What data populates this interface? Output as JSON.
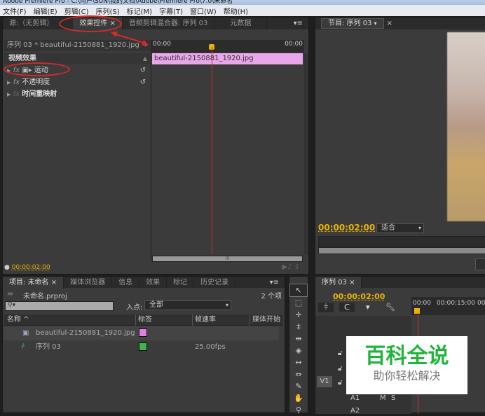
{
  "window": {
    "title": "Adobe Premiere Pro - C:\\用户\\SUN\\我的文档\\Adobe\\Premiere Pro\\7.0\\未命名"
  },
  "menu": [
    "文件(F)",
    "编辑(E)",
    "剪辑(C)",
    "序列(S)",
    "标记(M)",
    "字幕(T)",
    "窗口(W)",
    "帮助(H)"
  ],
  "top_left": {
    "tabs": [
      "源:（无剪辑）",
      "效果控件 ×",
      "音频剪辑混合器: 序列 03",
      "元数据"
    ],
    "header": "序列 03 * beautiful-2150881_1920.jpg",
    "ruler_start": "00:00",
    "ruler_end": "00:00",
    "clip": "beautiful-2150881_1920.jpg",
    "section": "视频效果",
    "effects": [
      {
        "fx": "fx",
        "label": "运动"
      },
      {
        "fx": "fx",
        "label": "不透明度"
      },
      {
        "fx": "fx",
        "label": "时间重映射"
      }
    ],
    "timecode": "00:00:02:00",
    "scroll_thumb": "III"
  },
  "program": {
    "tab": "节目: 序列 03",
    "timecode": "00:00:02:00",
    "fit": "适合"
  },
  "project": {
    "tabs": [
      "项目: 未命名 ×",
      "媒体浏览器",
      "信息",
      "效果",
      "标记",
      "历史记录"
    ],
    "file": "未命名.prproj",
    "count": "2 个项",
    "search_placeholder": "",
    "inpoint_label": "入点:",
    "inpoint_value": "全部",
    "columns": [
      "名称",
      "标签",
      "帧速率",
      "媒体开始"
    ],
    "items": [
      {
        "name": "beautiful-2150881_1920.jpg",
        "label_color": "#e37fe0",
        "fps": ""
      },
      {
        "name": "序列 03",
        "label_color": "#3cb54a",
        "fps": "25.00fps"
      }
    ]
  },
  "timeline": {
    "tab": "序列 03 ×",
    "timecode": "00:00:02:00",
    "ruler": [
      "00:00",
      "00:00:15:00",
      "00"
    ],
    "tracks": [
      "V1",
      "A1",
      "A2"
    ],
    "track_btns": [
      "M",
      "S"
    ]
  },
  "watermark": {
    "title": "百科全说",
    "subtitle": "助你轻松解决"
  }
}
